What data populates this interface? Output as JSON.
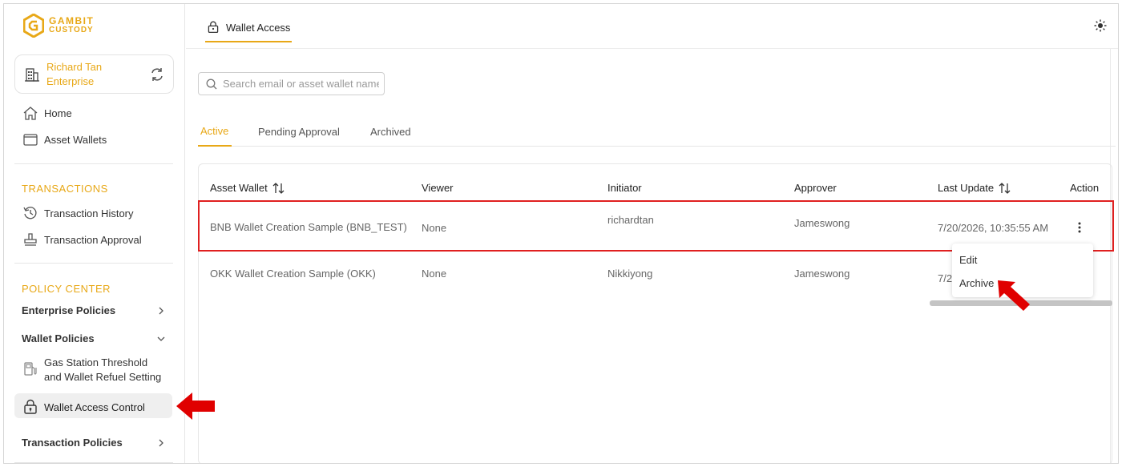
{
  "brand": {
    "line1": "GAMBIT",
    "line2": "CUSTODY"
  },
  "enterprise": {
    "name": "Richard Tan Enterprise"
  },
  "sidebar": {
    "home": "Home",
    "asset_wallets": "Asset Wallets",
    "transactions_title": "TRANSACTIONS",
    "transaction_history": "Transaction History",
    "transaction_approval": "Transaction Approval",
    "policy_center_title": "POLICY CENTER",
    "enterprise_policies": "Enterprise Policies",
    "wallet_policies": "Wallet Policies",
    "gas_station": "Gas Station Threshold and Wallet Refuel Setting",
    "wallet_access_control": "Wallet Access Control",
    "transaction_policies": "Transaction Policies"
  },
  "header": {
    "tab_title": "Wallet Access"
  },
  "search": {
    "placeholder": "Search email or asset wallet name"
  },
  "tabs": [
    {
      "label": "Active"
    },
    {
      "label": "Pending Approval"
    },
    {
      "label": "Archived"
    }
  ],
  "table": {
    "columns": [
      "Asset Wallet",
      "Viewer",
      "Initiator",
      "Approver",
      "Last Update",
      "Action"
    ],
    "rows": [
      {
        "asset_wallet": "BNB Wallet Creation Sample (BNB_TEST)",
        "viewer": "None",
        "initiator": "richardtan",
        "approver": "Jameswong",
        "last_update": "7/20/2026, 10:35:55 AM"
      },
      {
        "asset_wallet": "OKK Wallet Creation Sample (OKK)",
        "viewer": "None",
        "initiator": "Nikkiyong",
        "approver": "Jameswong",
        "last_update": "7/2"
      }
    ]
  },
  "action_menu": {
    "edit": "Edit",
    "archive": "Archive"
  },
  "colors": {
    "accent": "#e8a817",
    "highlight": "#e02020",
    "arrow": "#e00000"
  }
}
